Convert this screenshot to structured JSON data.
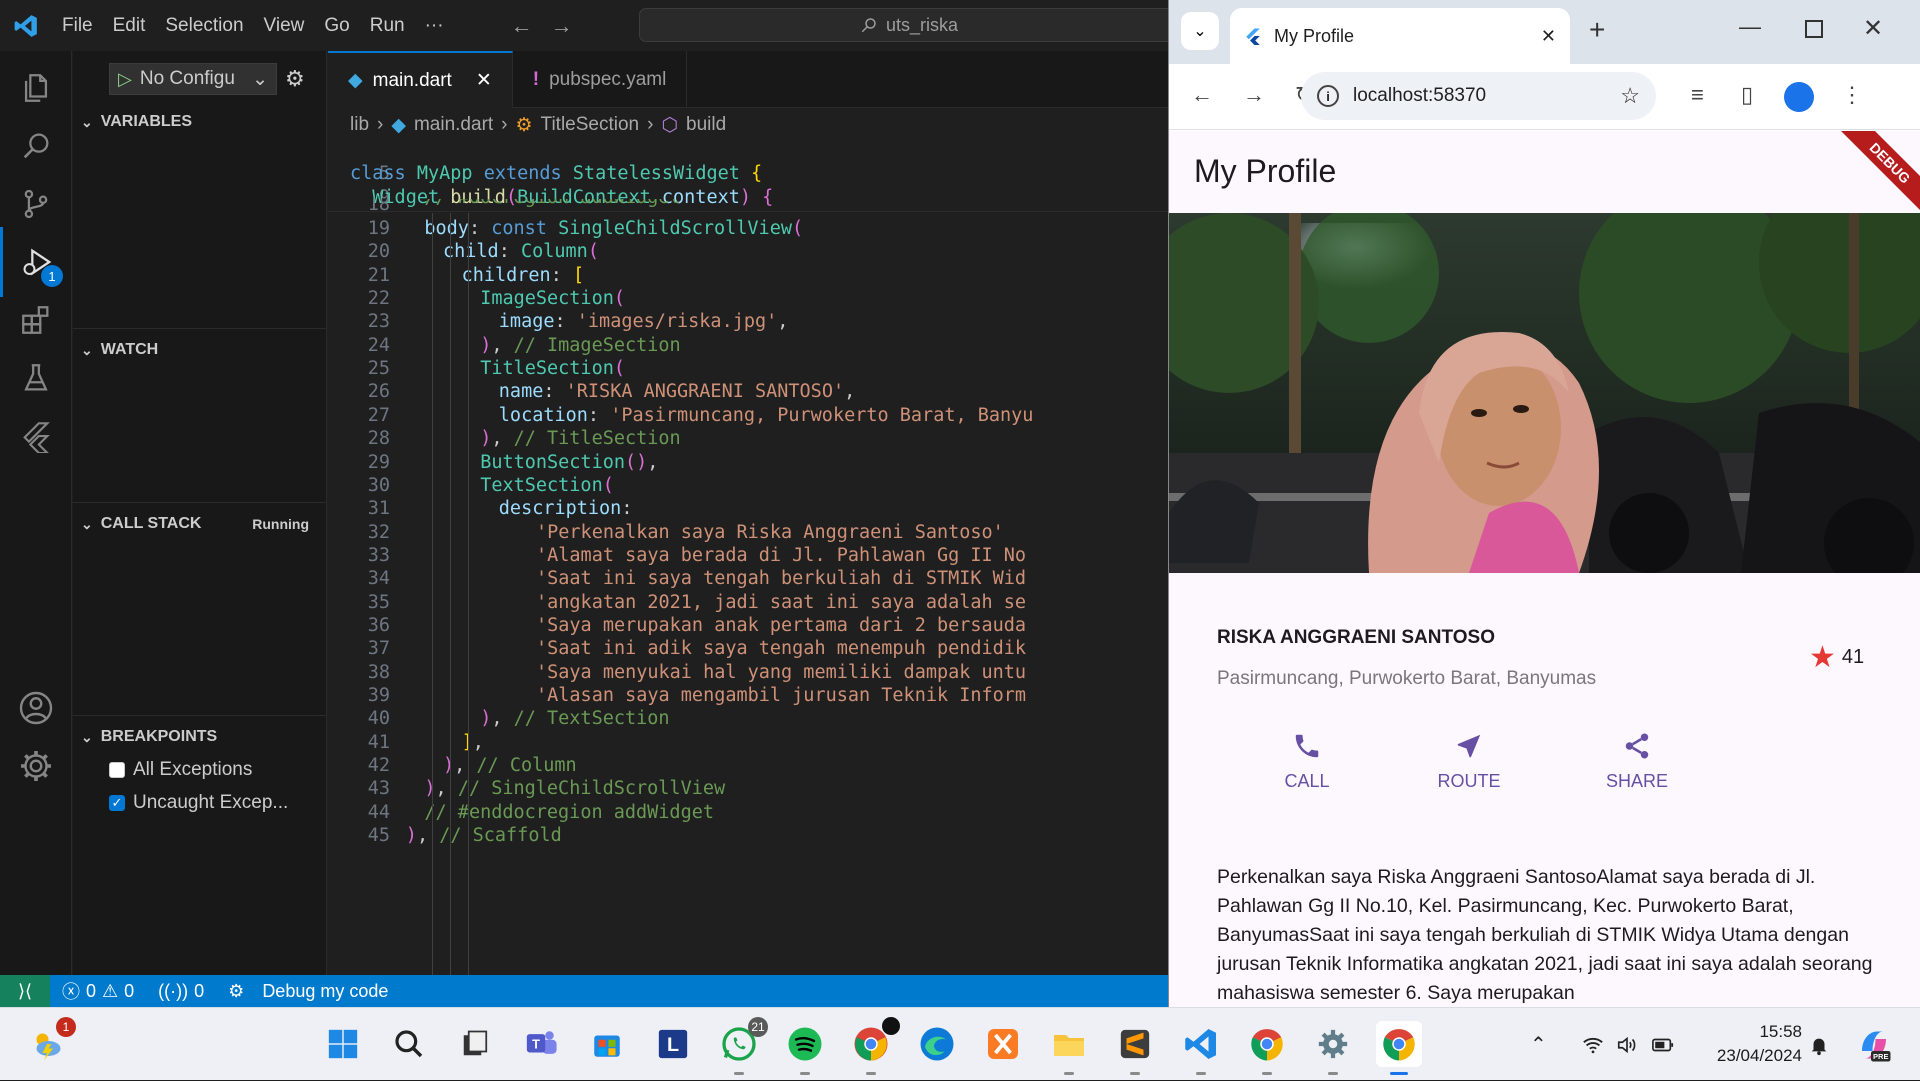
{
  "vscode": {
    "menu": [
      "File",
      "Edit",
      "Selection",
      "View",
      "Go",
      "Run",
      "···"
    ],
    "command_center": "uts_riska",
    "run_config": "No Configu",
    "debug_badge": "1",
    "sections": {
      "variables": "VARIABLES",
      "watch": "WATCH",
      "call_stack": "CALL STACK",
      "call_stack_status": "Running",
      "breakpoints": "BREAKPOINTS"
    },
    "breakpoints": [
      {
        "label": "All Exceptions",
        "checked": false
      },
      {
        "label": "Uncaught Excep...",
        "checked": true
      }
    ],
    "tabs": [
      {
        "label": "main.dart",
        "active": true
      },
      {
        "label": "pubspec.yaml",
        "active": false
      }
    ],
    "breadcrumb": [
      "lib",
      "main.dart",
      "TitleSection",
      "build"
    ],
    "sticky": [
      {
        "n": "5",
        "text": "class MyApp extends StatelessWidget {"
      },
      {
        "n": "9",
        "text": "  Widget build(BuildContext context) {"
      }
    ],
    "partial_line": {
      "n": "18",
      "text": "// #docregion addWidget"
    },
    "lines": [
      {
        "n": "19",
        "text": "body: const SingleChildScrollView("
      },
      {
        "n": "20",
        "text": "child: Column("
      },
      {
        "n": "21",
        "text": "children: ["
      },
      {
        "n": "22",
        "text": "ImageSection("
      },
      {
        "n": "23",
        "text": "image: 'images/riska.jpg',"
      },
      {
        "n": "24",
        "text": "), // ImageSection"
      },
      {
        "n": "25",
        "text": "TitleSection("
      },
      {
        "n": "26",
        "text": "name: 'RISKA ANGGRAENI SANTOSO',"
      },
      {
        "n": "27",
        "text": "location: 'Pasirmuncang, Purwokerto Barat, Banyu"
      },
      {
        "n": "28",
        "text": "), // TitleSection"
      },
      {
        "n": "29",
        "text": "ButtonSection(),"
      },
      {
        "n": "30",
        "text": "TextSection("
      },
      {
        "n": "31",
        "text": "description:"
      },
      {
        "n": "32",
        "text": "'Perkenalkan saya Riska Anggraeni Santoso'"
      },
      {
        "n": "33",
        "text": "'Alamat saya berada di Jl. Pahlawan Gg II No"
      },
      {
        "n": "34",
        "text": "'Saat ini saya tengah berkuliah di STMIK Wid"
      },
      {
        "n": "35",
        "text": "'angkatan 2021, jadi saat ini saya adalah se"
      },
      {
        "n": "36",
        "text": "'Saya merupakan anak pertama dari 2 bersauda"
      },
      {
        "n": "37",
        "text": "'Saat ini adik saya tengah menempuh pendidik"
      },
      {
        "n": "38",
        "text": "'Saya menyukai hal yang memiliki dampak untu"
      },
      {
        "n": "39",
        "text": "'Alasan saya mengambil jurusan Teknik Inform"
      },
      {
        "n": "40",
        "text": "), // TextSection"
      },
      {
        "n": "41",
        "text": "],"
      },
      {
        "n": "42",
        "text": "), // Column"
      },
      {
        "n": "43",
        "text": "), // SingleChildScrollView"
      },
      {
        "n": "44",
        "text": "// #enddocregion addWidget"
      },
      {
        "n": "45",
        "text": "), // Scaffold"
      }
    ],
    "status": {
      "errors": "0",
      "warnings": "0",
      "ports": "0",
      "debug_label": "Debug my code"
    }
  },
  "chrome": {
    "tab_title": "My Profile",
    "url": "localhost:58370",
    "page": {
      "appbar_title": "My Profile",
      "debug_banner": "DEBUG",
      "name": "RISKA ANGGRAENI SANTOSO",
      "location": "Pasirmuncang, Purwokerto Barat, Banyumas",
      "star_count": "41",
      "buttons": [
        "CALL",
        "ROUTE",
        "SHARE"
      ],
      "description": "Perkenalkan saya Riska Anggraeni SantosoAlamat saya berada di Jl. Pahlawan Gg II No.10, Kel. Pasirmuncang, Kec. Purwokerto Barat, BanyumasSaat ini saya tengah berkuliah di STMIK Widya Utama dengan jurusan Teknik Informatika angkatan 2021, jadi saat ini saya adalah seorang mahasiswa semester 6. Saya merupakan"
    }
  },
  "taskbar": {
    "notification_badge": "1",
    "whatsapp_badge": "21",
    "time": "15:58",
    "date": "23/04/2024",
    "copilot_label": "PRE"
  },
  "colors": {
    "vscode_accent": "#0078d4",
    "statusbar": "#007acc",
    "flutter_primary": "#6750a4",
    "star": "#e53935"
  }
}
